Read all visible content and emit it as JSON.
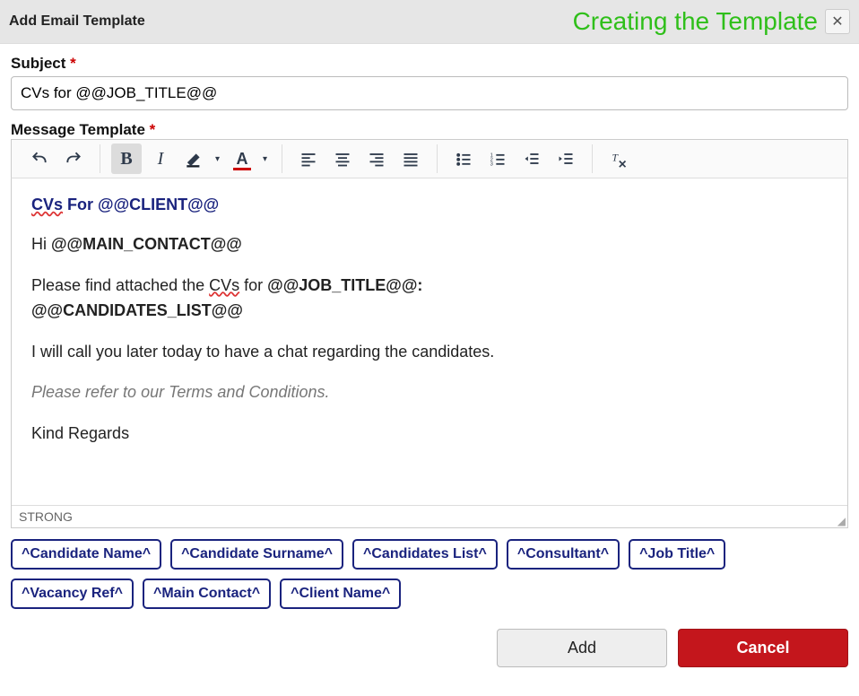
{
  "dialog": {
    "title": "Add Email Template",
    "annotation": "Creating the Template",
    "close_label": "✕"
  },
  "subject": {
    "label": "Subject",
    "value": "CVs for @@JOB_TITLE@@"
  },
  "message": {
    "label": "Message Template",
    "status_path": "STRONG"
  },
  "body": {
    "heading_prefix": "CVs",
    "heading_rest": " For @@CLIENT@@",
    "greeting_prefix": "Hi ",
    "greeting_token": "@@MAIN_CONTACT@@",
    "para2_a": "Please find attached the ",
    "para2_cvs": "CVs",
    "para2_b": " for ",
    "para2_token": "@@JOB_TITLE@@:",
    "para2_list": "@@CANDIDATES_LIST@@",
    "para3": "I will call you later today to have a chat regarding the candidates.",
    "para4": "Please refer to our Terms and Conditions.",
    "para5": "Kind Regards"
  },
  "tokens": [
    "^Candidate Name^",
    "^Candidate Surname^",
    "^Candidates List^",
    "^Consultant^",
    "^Job Title^",
    "^Vacancy Ref^",
    "^Main Contact^",
    "^Client Name^"
  ],
  "footer": {
    "add": "Add",
    "cancel": "Cancel"
  },
  "toolbar": {
    "bold_glyph": "B",
    "italic_glyph": "I",
    "textcolor_glyph": "A"
  }
}
